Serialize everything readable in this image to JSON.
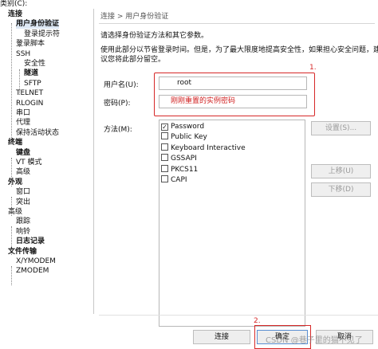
{
  "window": {
    "category_label": "类别(C):"
  },
  "tree": [
    {
      "label": "连接",
      "depth": 0,
      "bold": true
    },
    {
      "label": "用户身份验证",
      "depth": 1,
      "bold": true,
      "selected": true
    },
    {
      "label": "登录提示符",
      "depth": 2,
      "bold": false
    },
    {
      "label": "登录脚本",
      "depth": 1,
      "bold": false
    },
    {
      "label": "SSH",
      "depth": 1,
      "bold": false
    },
    {
      "label": "安全性",
      "depth": 2,
      "bold": false
    },
    {
      "label": "隧道",
      "depth": 2,
      "bold": true
    },
    {
      "label": "SFTP",
      "depth": 2,
      "bold": false
    },
    {
      "label": "TELNET",
      "depth": 1,
      "bold": false
    },
    {
      "label": "RLOGIN",
      "depth": 1,
      "bold": false
    },
    {
      "label": "串口",
      "depth": 1,
      "bold": false
    },
    {
      "label": "代理",
      "depth": 1,
      "bold": false
    },
    {
      "label": "保持活动状态",
      "depth": 1,
      "bold": false
    },
    {
      "label": "终端",
      "depth": 0,
      "bold": true
    },
    {
      "label": "键盘",
      "depth": 1,
      "bold": true
    },
    {
      "label": "VT 模式",
      "depth": 1,
      "bold": false
    },
    {
      "label": "高级",
      "depth": 1,
      "bold": false
    },
    {
      "label": "外观",
      "depth": 0,
      "bold": true
    },
    {
      "label": "窗口",
      "depth": 1,
      "bold": false
    },
    {
      "label": "突出",
      "depth": 1,
      "bold": false
    },
    {
      "label": "高级",
      "depth": 0,
      "bold": false
    },
    {
      "label": "跟踪",
      "depth": 1,
      "bold": false
    },
    {
      "label": "响铃",
      "depth": 1,
      "bold": false
    },
    {
      "label": "日志记录",
      "depth": 1,
      "bold": true
    },
    {
      "label": "文件传输",
      "depth": 0,
      "bold": true
    },
    {
      "label": "X/YMODEM",
      "depth": 1,
      "bold": false
    },
    {
      "label": "ZMODEM",
      "depth": 1,
      "bold": false
    }
  ],
  "content": {
    "breadcrumb": "连接 > 用户身份验证",
    "intro": "请选择身份验证方法和其它参数。",
    "desc_line1": "使用此部分以节省登录时间。但是，为了最大限度地提高安全性，如果担心安全问题，建",
    "desc_line2": "议您将此部分留空。",
    "username_label": "用户名(U):",
    "username_value": "root",
    "password_label": "密码(P):",
    "password_note": "刚刚重置的实例密码",
    "method_label": "方法(M):",
    "methods": [
      {
        "label": "Password",
        "checked": true
      },
      {
        "label": "Public Key",
        "checked": false
      },
      {
        "label": "Keyboard Interactive",
        "checked": false
      },
      {
        "label": "GSSAPI",
        "checked": false
      },
      {
        "label": "PKCS11",
        "checked": false
      },
      {
        "label": "CAPI",
        "checked": false
      }
    ],
    "settings_button": "设置(S)...",
    "move_up_button": "上移(U)",
    "move_down_button": "下移(D)"
  },
  "annotations": {
    "step1": "1.",
    "step2": "2.",
    "accent_color": "#d62828"
  },
  "footer": {
    "connect_button": "连接",
    "ok_button": "确定",
    "cancel_button": "取消"
  },
  "watermark": "CSDN @巷子里的猫不见了"
}
